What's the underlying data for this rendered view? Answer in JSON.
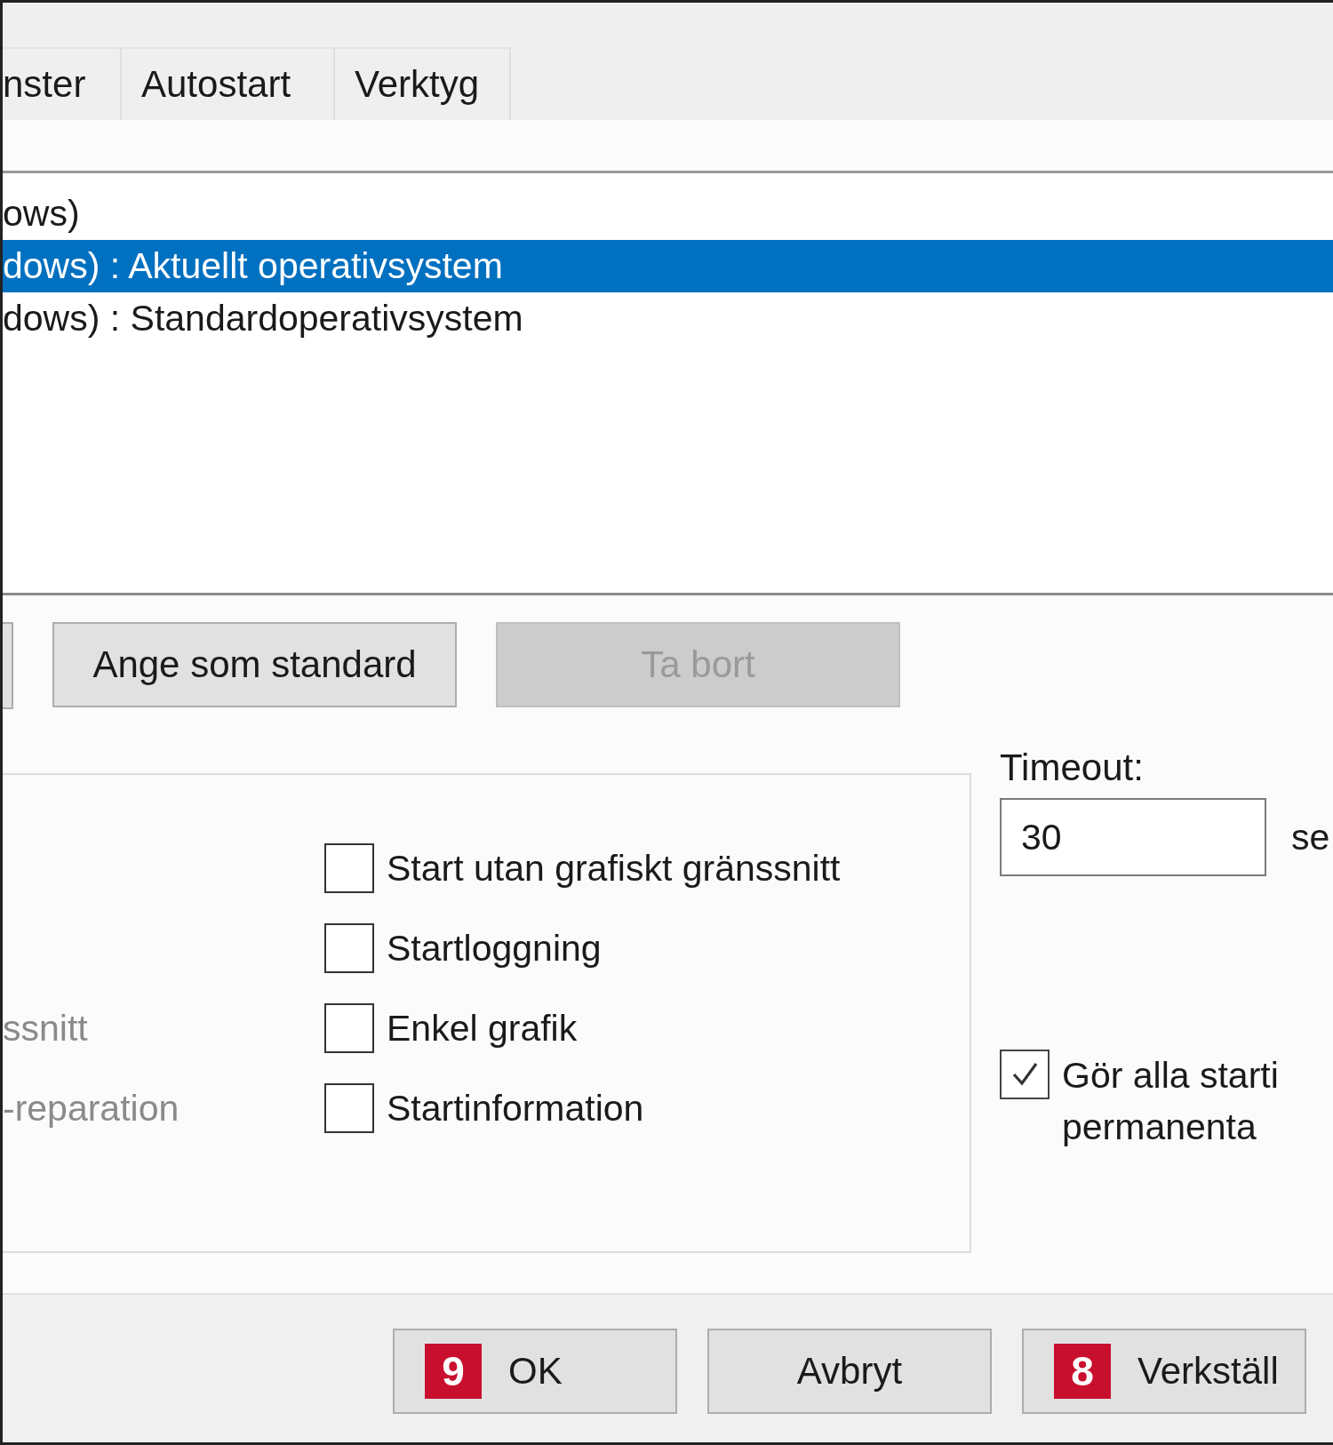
{
  "tabs": [
    {
      "label": "nster",
      "selected": false
    },
    {
      "label": "Autostart",
      "selected": false
    },
    {
      "label": "Verktyg",
      "selected": false
    }
  ],
  "os_list": [
    {
      "text": "ows)",
      "selected": false
    },
    {
      "text": "dows) : Aktuellt operativsystem",
      "selected": true
    },
    {
      "text": "dows) : Standardoperativsystem",
      "selected": false
    }
  ],
  "list_buttons": [
    {
      "label": "Ange som standard",
      "disabled": false
    },
    {
      "label": "Ta bort",
      "disabled": true
    }
  ],
  "boot_options_left": [
    {
      "label": "ssnitt",
      "disabled": true
    },
    {
      "label": "-reparation",
      "disabled": true
    }
  ],
  "boot_options": [
    {
      "label": "Start utan grafiskt gränssnitt",
      "checked": false
    },
    {
      "label": "Startloggning",
      "checked": false
    },
    {
      "label": "Enkel grafik",
      "checked": false
    },
    {
      "label": "Startinformation",
      "checked": false
    }
  ],
  "timeout": {
    "label": "Timeout:",
    "value": "30",
    "unit": "se"
  },
  "permanent": {
    "lines": [
      "Gör alla starti",
      "permanenta"
    ],
    "checked": true
  },
  "footer_buttons": [
    {
      "label": "OK",
      "badge": "9"
    },
    {
      "label": "Avbryt"
    },
    {
      "label": "Verkställ",
      "badge": "8"
    }
  ]
}
